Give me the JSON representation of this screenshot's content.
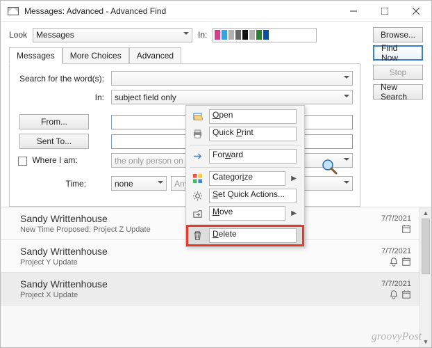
{
  "window": {
    "title": "Messages: Advanced - Advanced Find"
  },
  "lookrow": {
    "look_label": "Look",
    "look_value": "Messages",
    "in_label": "In:",
    "browse_label": "Browse..."
  },
  "actions": {
    "find_now": "Find Now",
    "stop": "Stop",
    "new_search": "New Search"
  },
  "tabs": [
    "Messages",
    "More Choices",
    "Advanced"
  ],
  "form": {
    "search_words_label": "Search for the word(s):",
    "search_words_value": "",
    "in_label": "In:",
    "in_value": "subject field only",
    "from_label": "From...",
    "from_value": "",
    "sent_to_label": "Sent To...",
    "sent_to_value": "",
    "where_label": "Where I am:",
    "where_value": "the only person on the To line",
    "time_label": "Time:",
    "time_value": "none",
    "time_range": "Anytime"
  },
  "context_menu": {
    "open": "Open",
    "quick_print": "Quick Print",
    "forward": "Forward",
    "categorize": "Categorize",
    "set_quick_actions": "Set Quick Actions...",
    "move": "Move",
    "delete": "Delete"
  },
  "results": [
    {
      "sender": "Sandy Writtenhouse",
      "subject": "New Time Proposed: Project Z Update",
      "date": "7/7/2021",
      "icons": [
        "calendar"
      ]
    },
    {
      "sender": "Sandy Writtenhouse",
      "subject": "Project Y Update",
      "date": "7/7/2021",
      "icons": [
        "bell",
        "calendar"
      ]
    },
    {
      "sender": "Sandy Writtenhouse",
      "subject": "Project X Update",
      "date": "7/7/2021",
      "icons": [
        "bell",
        "calendar"
      ]
    }
  ],
  "watermark": "groovyPost"
}
